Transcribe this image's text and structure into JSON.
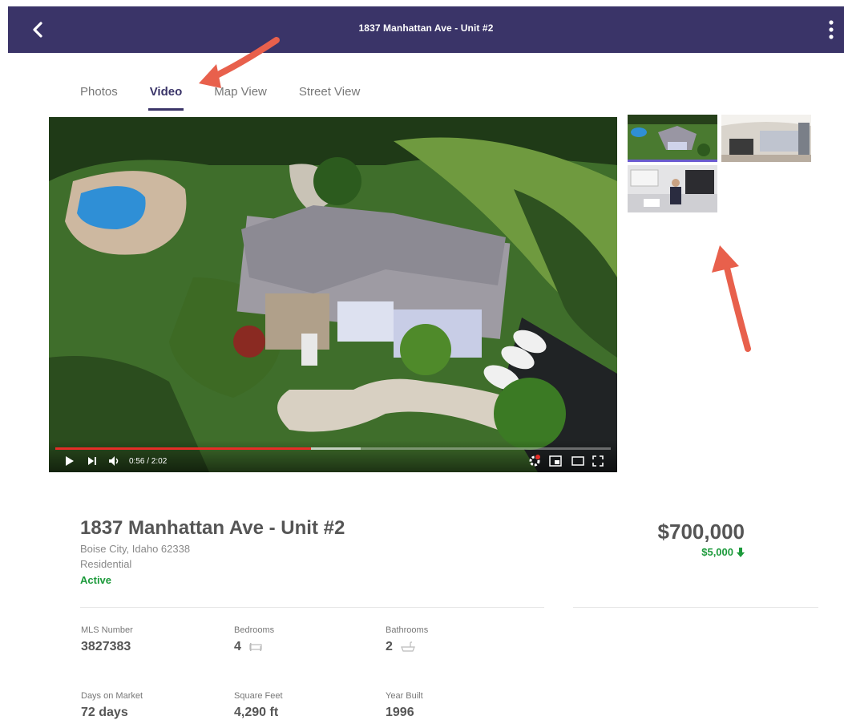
{
  "header": {
    "title": "1837 Manhattan Ave - Unit #2",
    "back_icon": "chevron-left-icon",
    "menu_icon": "vertical-dots-icon",
    "bar_color": "#3a3468"
  },
  "tabs": [
    {
      "label": "Photos",
      "active": false
    },
    {
      "label": "Video",
      "active": true
    },
    {
      "label": "Map View",
      "active": false
    },
    {
      "label": "Street View",
      "active": false
    }
  ],
  "video": {
    "current_time": "0:56 / 2:02",
    "progress_fraction": 0.46,
    "buffered_fraction": 0.55,
    "controls": [
      "play-icon",
      "next-icon",
      "volume-icon",
      "settings-icon",
      "miniplayer-icon",
      "theater-icon",
      "fullscreen-icon"
    ],
    "progress_color": "#e52d27"
  },
  "thumbnails": [
    {
      "name": "aerial-house-thumbnail",
      "active": true
    },
    {
      "name": "interior-living-thumbnail",
      "active": false
    },
    {
      "name": "kitchen-agent-thumbnail",
      "active": false
    }
  ],
  "listing": {
    "address": "1837 Manhattan Ave - Unit #2",
    "city_line": "Boise City, Idaho 62338",
    "type": "Residential",
    "status": "Active",
    "status_color": "#1c9a3b",
    "price": "$700,000",
    "price_change": "$5,000",
    "price_change_icon": "arrow-down-icon"
  },
  "facts": [
    {
      "label": "MLS Number",
      "value": "3827383",
      "icon": ""
    },
    {
      "label": "Bedrooms",
      "value": "4",
      "icon": "bed-icon"
    },
    {
      "label": "Bathrooms",
      "value": "2",
      "icon": "bathtub-icon"
    },
    {
      "label": "Days on Market",
      "value": "72 days",
      "icon": ""
    },
    {
      "label": "Square Feet",
      "value": "4,290 ft",
      "icon": ""
    },
    {
      "label": "Year Built",
      "value": "1996",
      "icon": ""
    }
  ]
}
